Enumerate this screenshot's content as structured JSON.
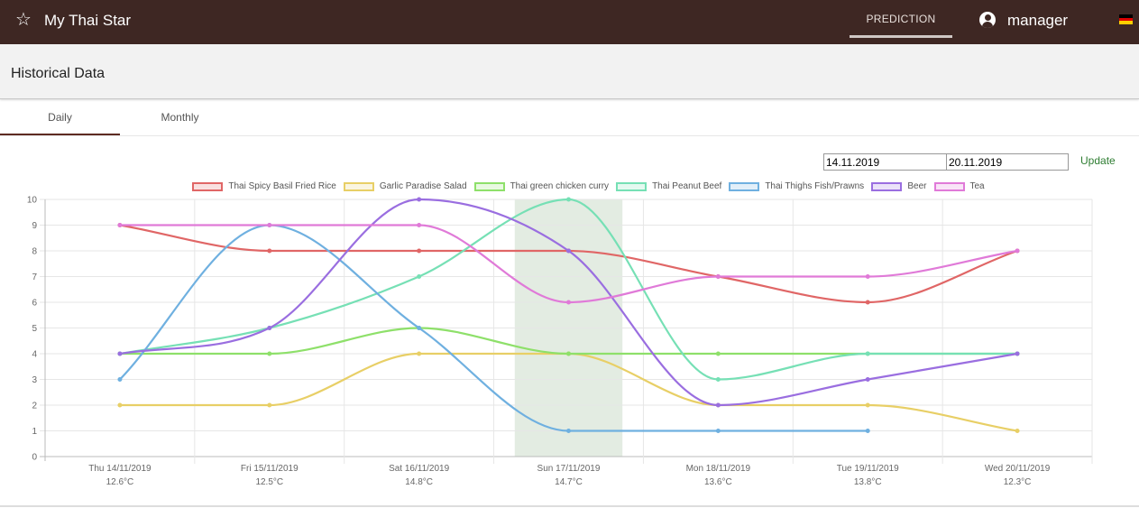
{
  "toolbar": {
    "icon": "star-outline-icon",
    "title": "My Thai Star",
    "nav_prediction": "PREDICTION",
    "user_icon": "account-circle-icon",
    "user_name": "manager",
    "flag_icon": "german-flag-icon",
    "colors": {
      "background": "#3e2723",
      "text": "#ffffff"
    }
  },
  "section": {
    "title": "Historical Data"
  },
  "tabs": [
    {
      "label": "Daily",
      "active": true
    },
    {
      "label": "Monthly",
      "active": false
    }
  ],
  "filter": {
    "start_date": "14.11.2019",
    "end_date": "20.11.2019",
    "update_label": "Update"
  },
  "chart_data": {
    "type": "line",
    "categories": [
      "Thu 14/11/2019",
      "Fri 15/11/2019",
      "Sat 16/11/2019",
      "Sun 17/11/2019",
      "Mon 18/11/2019",
      "Tue 19/11/2019",
      "Wed 20/11/2019"
    ],
    "temperatures": [
      "12.6°C",
      "12.5°C",
      "14.8°C",
      "14.7°C",
      "13.6°C",
      "13.8°C",
      "12.3°C"
    ],
    "ylim": [
      0,
      10
    ],
    "yticks": [
      "0",
      "1",
      "2",
      "3",
      "4",
      "5",
      "6",
      "7",
      "8",
      "9",
      "10"
    ],
    "highlight_category": "Sun 17/11/2019",
    "highlight_color": "#e3ece2",
    "grid": true,
    "legend_position": "top",
    "series": [
      {
        "name": "Thai Spicy Basil Fried Rice",
        "color": "#e06666",
        "values": [
          9,
          8,
          8,
          8,
          7,
          6,
          8
        ]
      },
      {
        "name": "Garlic Paradise Salad",
        "color": "#e8cf66",
        "values": [
          2,
          2,
          4,
          4,
          2,
          2,
          1
        ]
      },
      {
        "name": "Thai green chicken curry",
        "color": "#8ee06a",
        "values": [
          4,
          4,
          5,
          4,
          4,
          4,
          4
        ]
      },
      {
        "name": "Thai Peanut Beef",
        "color": "#76e0b5",
        "values": [
          4,
          5,
          7,
          10,
          3,
          4,
          4
        ]
      },
      {
        "name": "Thai Thighs Fish/Prawns",
        "color": "#6fb0e0",
        "values": [
          3,
          9,
          5,
          1,
          1,
          1,
          null
        ]
      },
      {
        "name": "Beer",
        "color": "#9a6ee0",
        "values": [
          4,
          5,
          10,
          8,
          2,
          3,
          4
        ]
      },
      {
        "name": "Tea",
        "color": "#e07ad8",
        "values": [
          9,
          9,
          9,
          6,
          7,
          7,
          8
        ]
      }
    ]
  }
}
